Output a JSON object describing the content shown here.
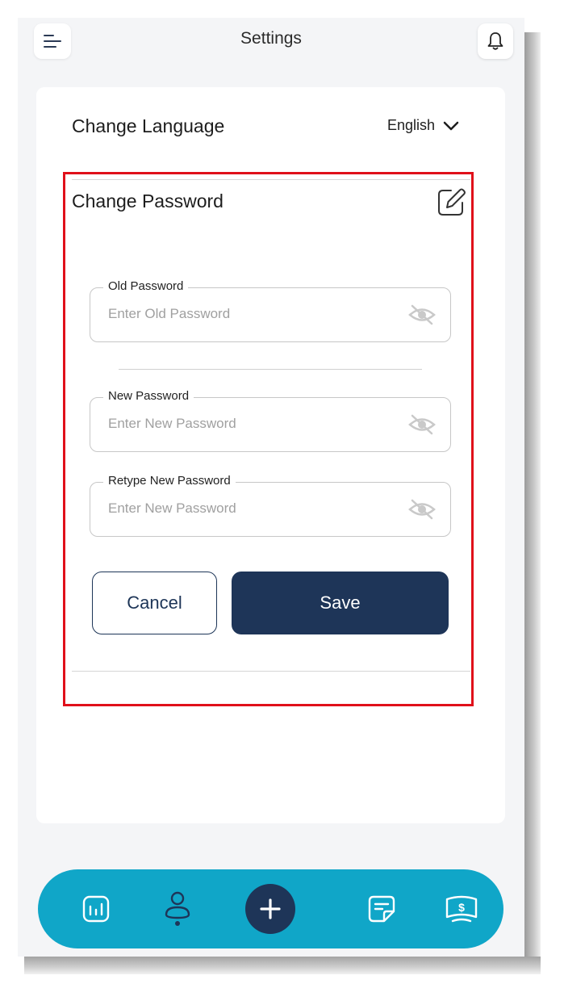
{
  "header": {
    "title": "Settings",
    "menu_icon": "menu-icon",
    "notification_icon": "bell-icon"
  },
  "language": {
    "label": "Change Language",
    "selected": "English"
  },
  "password": {
    "title": "Change Password",
    "edit_icon": "edit-icon",
    "fields": [
      {
        "label": "Old Password",
        "placeholder": "Enter Old Password",
        "value": ""
      },
      {
        "label": "New Password",
        "placeholder": "Enter New Password",
        "value": ""
      },
      {
        "label": "Retype New Password",
        "placeholder": "Enter New Password",
        "value": ""
      }
    ],
    "cancel_label": "Cancel",
    "save_label": "Save"
  },
  "bottom_nav": {
    "items": [
      "chart-icon",
      "profile-icon",
      "add-icon",
      "notes-icon",
      "money-icon"
    ]
  },
  "colors": {
    "primary": "#1e3558",
    "nav_bg": "#10a6c8",
    "highlight": "#e0101a",
    "page_bg": "#f4f5f7"
  }
}
